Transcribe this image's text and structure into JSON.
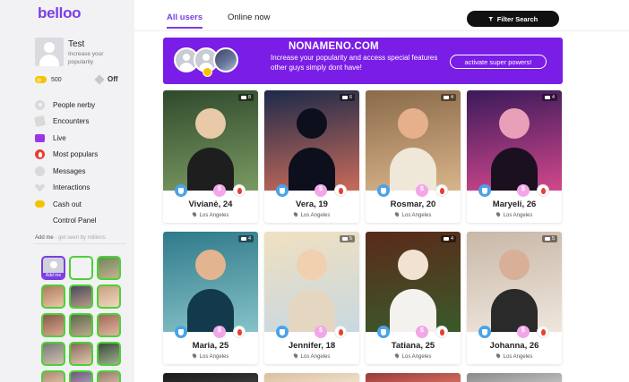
{
  "brand": {
    "logo": "belloo",
    "accent": "#7b3fe4",
    "banner_color": "#7a1de6",
    "online_color": "#4cd137"
  },
  "profile": {
    "name": "Test",
    "subtitle": "Increase your popularity",
    "coins": "500",
    "vip_status": "Off"
  },
  "sidebar": {
    "items": [
      {
        "label": "People nerby",
        "icon": "location-icon"
      },
      {
        "label": "Encounters",
        "icon": "cards-icon"
      },
      {
        "label": "Live",
        "icon": "video-icon"
      },
      {
        "label": "Most populars",
        "icon": "fire-icon"
      },
      {
        "label": "Messages",
        "icon": "chat-icon"
      },
      {
        "label": "Interactions",
        "icon": "heart-icon"
      },
      {
        "label": "Cash out",
        "icon": "coin-icon"
      },
      {
        "label": "Control Panel",
        "icon": ""
      }
    ],
    "addme_label": "Add me",
    "addme_hint": "- get seen by millions",
    "addme_tag": "Add me"
  },
  "tabs": [
    {
      "label": "All users",
      "active": true
    },
    {
      "label": "Online now",
      "active": false
    }
  ],
  "filter_button": "Filter Search",
  "banner": {
    "title": "NONAMENO.COM",
    "text": "Increase your popularity and access special features other guys simply dont have!",
    "button": "activate super powers!"
  },
  "cards": [
    {
      "name": "Vivianė, 24",
      "location": "Los Angeles",
      "photos": "8",
      "bg": [
        "#2f4a2c",
        "#7a9a62"
      ],
      "skin": "#e8c9a8",
      "torso": "#1e1e1e"
    },
    {
      "name": "Vera, 19",
      "location": "Los Angeles",
      "photos": "6",
      "bg": [
        "#1d2a4a",
        "#c96b5a"
      ],
      "skin": "#0d0f1c",
      "torso": "#0d0f1c"
    },
    {
      "name": "Rosmar, 20",
      "location": "Los Angeles",
      "photos": "4",
      "bg": [
        "#8a6a4a",
        "#d9b48a"
      ],
      "skin": "#e5b08b",
      "torso": "#efe7d8"
    },
    {
      "name": "Maryeli, 26",
      "location": "Los Angeles",
      "photos": "4",
      "bg": [
        "#3a1a5a",
        "#d2478c"
      ],
      "skin": "#e7a0b8",
      "torso": "#1a1020"
    },
    {
      "name": "Maria, 25",
      "location": "Los Angeles",
      "photos": "4",
      "bg": [
        "#2f7a8a",
        "#86c2c8"
      ],
      "skin": "#e3b48f",
      "torso": "#123a4c"
    },
    {
      "name": "Jennifer, 18",
      "location": "Los Angeles",
      "photos": "5",
      "bg": [
        "#f0e0c0",
        "#c8d8e0"
      ],
      "skin": "#f0d0ae",
      "torso": "#e4d6c0"
    },
    {
      "name": "Tatiana, 25",
      "location": "Los Angeles",
      "photos": "4",
      "bg": [
        "#5a2a1a",
        "#3a5a2a"
      ],
      "skin": "#f2e2d2",
      "torso": "#f4f2ee"
    },
    {
      "name": "Johanna, 26",
      "location": "Los Angeles",
      "photos": "5",
      "bg": [
        "#c8b8a8",
        "#efe6dc"
      ],
      "skin": "#d8b098",
      "torso": "#2a2a2a"
    }
  ],
  "partial_cards": [
    {
      "bg": [
        "#1a1a1a",
        "#3a3a3a"
      ]
    },
    {
      "bg": [
        "#d8c0a0",
        "#f0e0cc"
      ]
    },
    {
      "bg": [
        "#9a3a3a",
        "#d07060"
      ]
    },
    {
      "bg": [
        "#8a8a8a",
        "#c0c0c0"
      ]
    }
  ],
  "thumbs": [
    {
      "type": "me"
    },
    {
      "type": "empty"
    },
    {
      "c": [
        "#6a8a5a",
        "#c8b090"
      ]
    },
    {
      "c": [
        "#b07a60",
        "#e8c8a8"
      ]
    },
    {
      "c": [
        "#4a4a5a",
        "#b89a8a"
      ]
    },
    {
      "c": [
        "#c8a080",
        "#f0d8c0"
      ]
    },
    {
      "c": [
        "#8a5a4a",
        "#d8a890"
      ]
    },
    {
      "c": [
        "#5a6a4a",
        "#c0a890"
      ]
    },
    {
      "c": [
        "#a06a5a",
        "#e0b8a0"
      ]
    },
    {
      "c": [
        "#7a7a7a",
        "#d0c0b0"
      ]
    },
    {
      "c": [
        "#8a6a5a",
        "#e0c8b0"
      ]
    },
    {
      "c": [
        "#3a4a3a",
        "#a0b090"
      ]
    },
    {
      "c": [
        "#b08870",
        "#f0d8c8"
      ]
    },
    {
      "c": [
        "#6a5a7a",
        "#c8b8d0"
      ]
    },
    {
      "c": [
        "#9a7a6a",
        "#e8d0c0"
      ]
    }
  ]
}
